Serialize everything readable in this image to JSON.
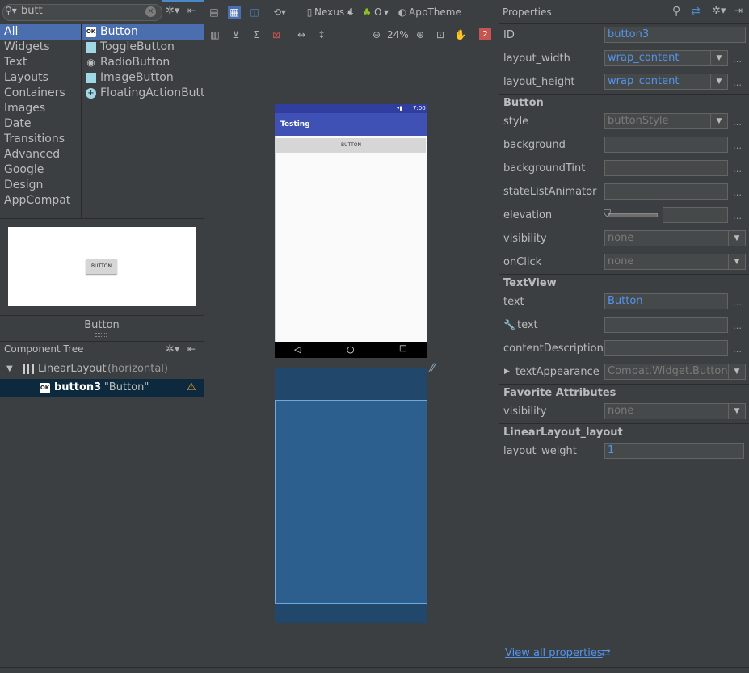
{
  "palette": {
    "search_value": "butt",
    "categories": [
      "All",
      "Widgets",
      "Text",
      "Layouts",
      "Containers",
      "Images",
      "Date",
      "Transitions",
      "Advanced",
      "Google",
      "Design",
      "AppCompat"
    ],
    "components": [
      "Button",
      "ToggleButton",
      "RadioButton",
      "ImageButton",
      "FloatingActionButton"
    ],
    "preview_button_text": "BUTTON",
    "preview_label": "Button"
  },
  "component_tree": {
    "title": "Component Tree",
    "root": "LinearLayout",
    "root_qualifier": "(horizontal)",
    "child_id": "button3",
    "child_text": " - \"Button\""
  },
  "toolbar": {
    "device": "Nexus 4",
    "api": "O",
    "theme": "AppTheme",
    "zoom": "24%",
    "error_count": "2"
  },
  "device_preview": {
    "status_time": "7:00",
    "app_title": "Testing",
    "button_text": "BUTTON"
  },
  "properties": {
    "title": "Properties",
    "id_label": "ID",
    "id_value": "button3",
    "layout_width_label": "layout_width",
    "layout_width_value": "wrap_content",
    "layout_height_label": "layout_height",
    "layout_height_value": "wrap_content",
    "button_section": "Button",
    "style_label": "style",
    "style_value": "buttonStyle",
    "background_label": "background",
    "background_tint_label": "backgroundTint",
    "state_list_animator_label": "stateListAnimator",
    "elevation_label": "elevation",
    "visibility_label": "visibility",
    "visibility_value": "none",
    "onclick_label": "onClick",
    "onclick_value": "none",
    "textview_section": "TextView",
    "text_label": "text",
    "text_value": "Button",
    "tools_text_label": "text",
    "content_description_label": "contentDescription",
    "text_appearance_label": "textAppearance",
    "text_appearance_value": "Compat.Widget.Button",
    "favorite_section": "Favorite Attributes",
    "fav_visibility_label": "visibility",
    "fav_visibility_value": "none",
    "linearlayout_section": "LinearLayout_layout",
    "layout_weight_label": "layout_weight",
    "layout_weight_value": "1",
    "view_all_link": "View all properties"
  },
  "colors": {
    "accent": "#4b6eaf",
    "link": "#5394ec",
    "app_bar": "#3f51b5",
    "blueprint": "#21476b",
    "error_badge": "#c75450",
    "warning": "#f0a732"
  }
}
